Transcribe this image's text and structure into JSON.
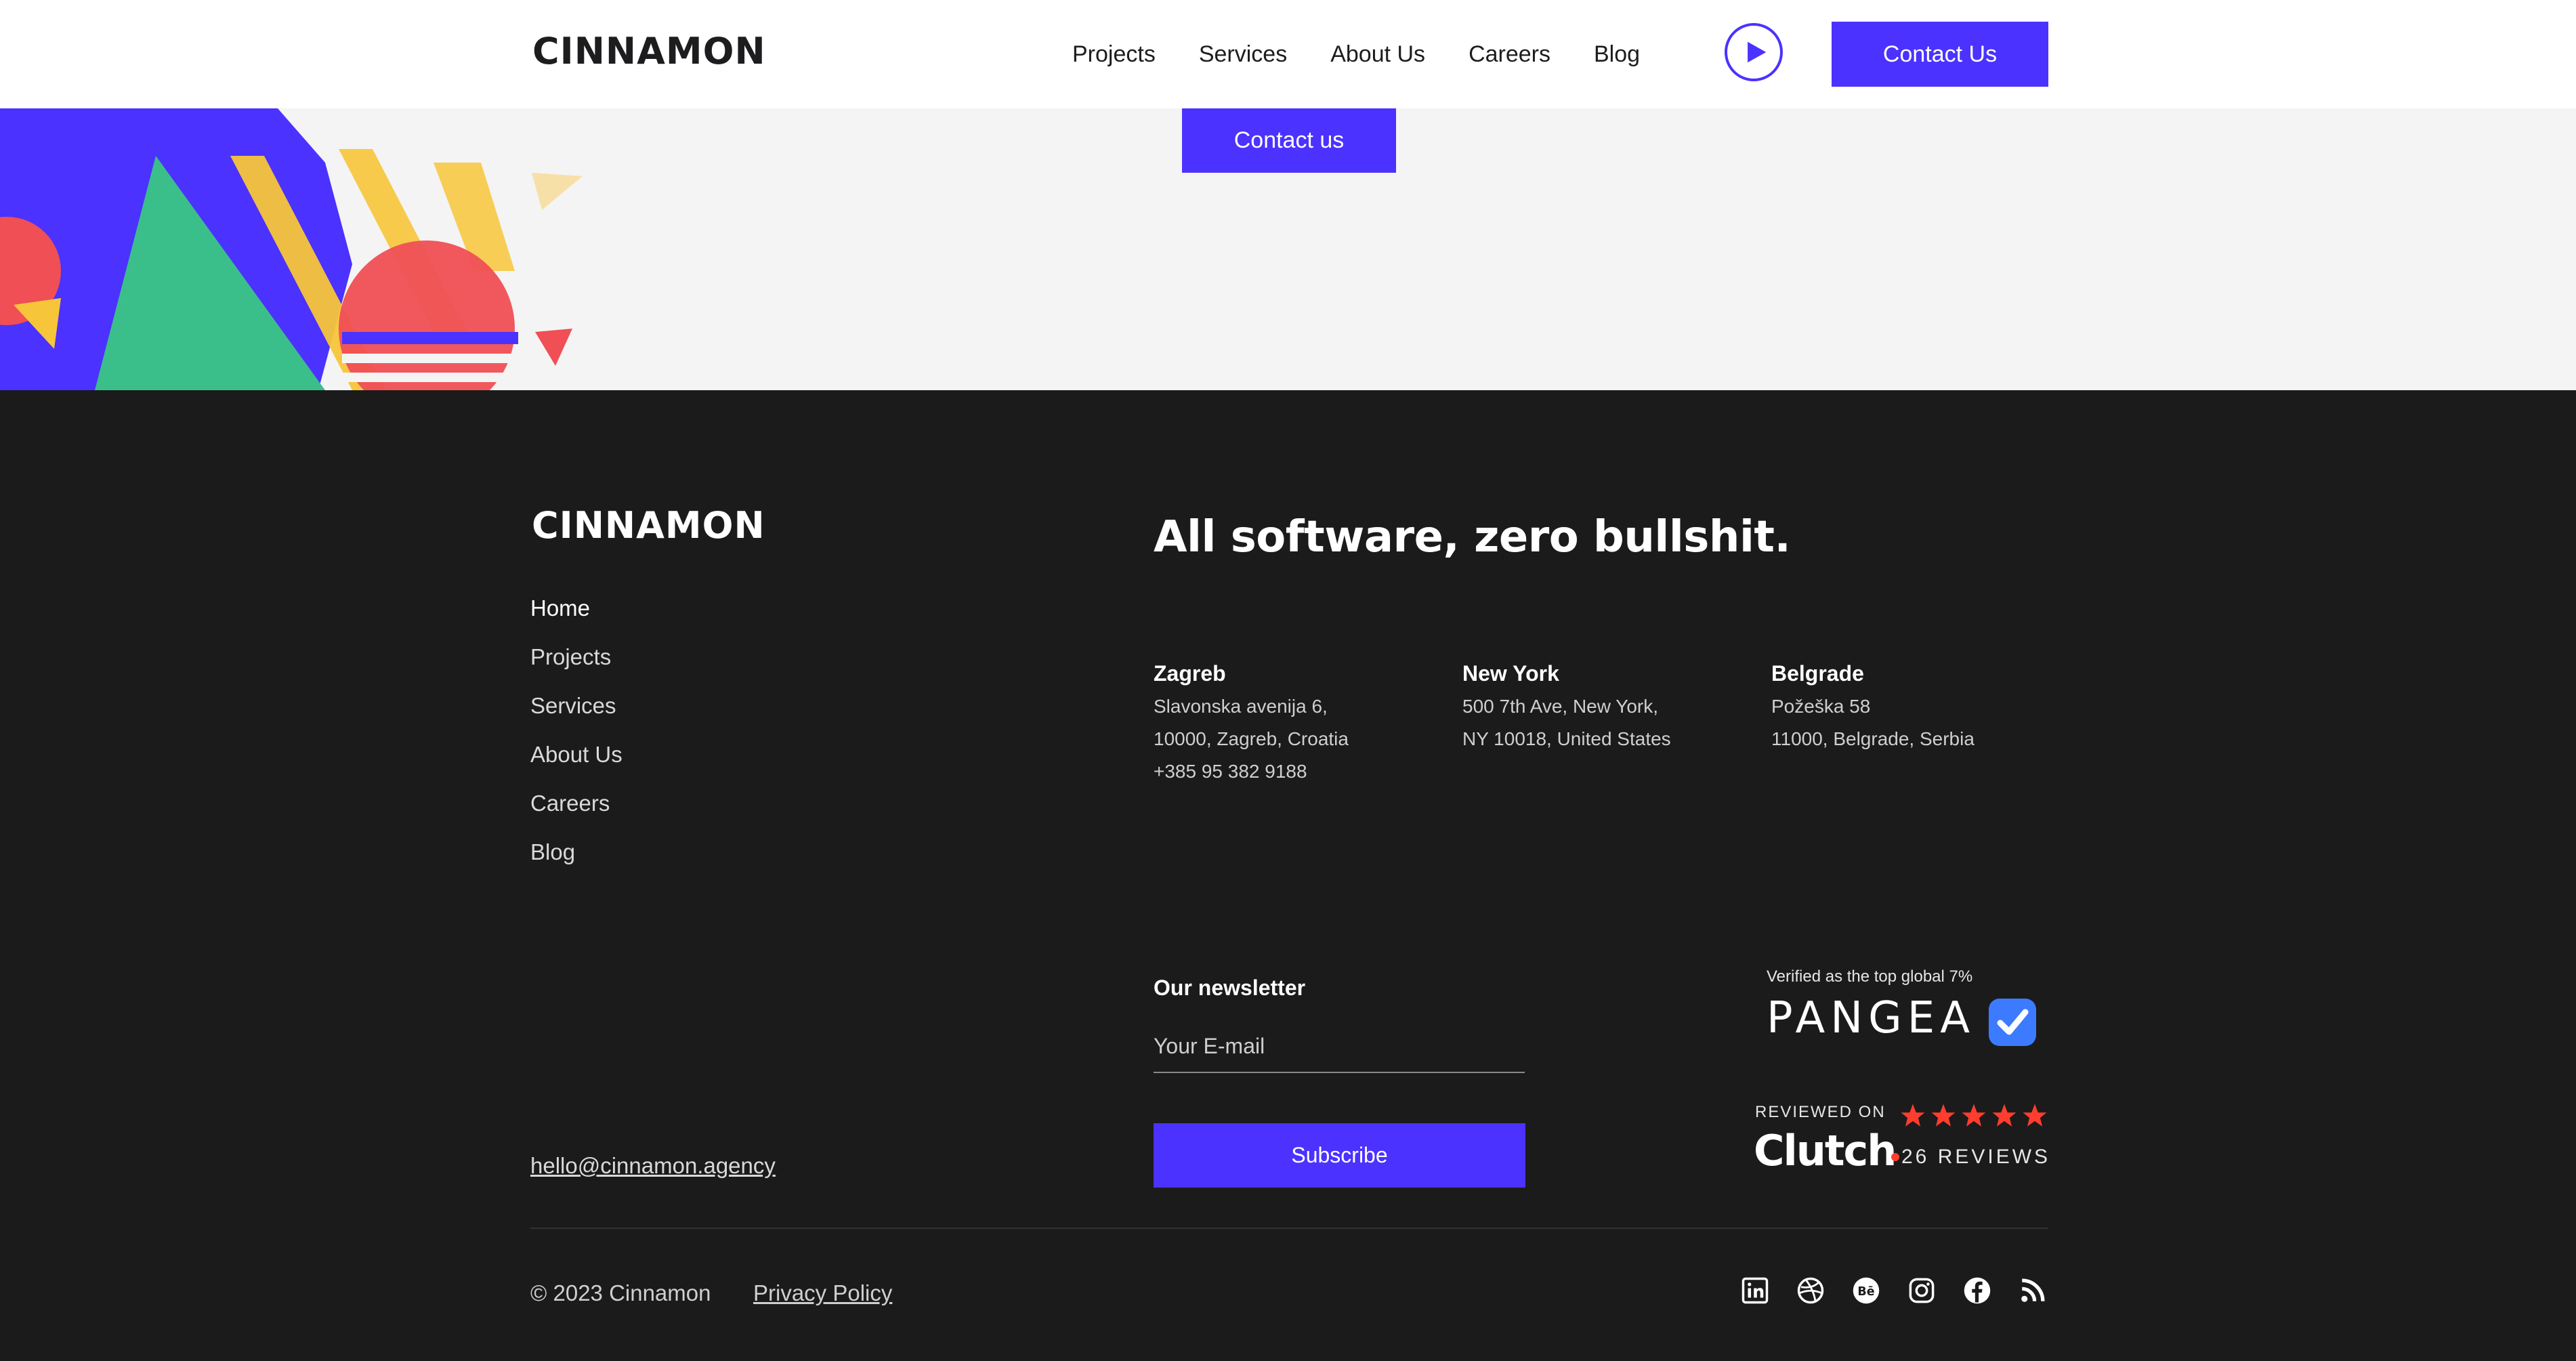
{
  "header": {
    "brand": "CINNAMON",
    "nav": [
      {
        "label": "Projects"
      },
      {
        "label": "Services"
      },
      {
        "label": "About Us"
      },
      {
        "label": "Careers"
      },
      {
        "label": "Blog"
      }
    ],
    "play_icon": "play-icon",
    "cta_label": "Contact Us"
  },
  "band": {
    "cta_label": "Contact us"
  },
  "footer": {
    "brand": "CINNAMON",
    "tagline": "All software, zero bullshit.",
    "nav": [
      {
        "label": "Home"
      },
      {
        "label": "Projects"
      },
      {
        "label": "Services"
      },
      {
        "label": "About Us"
      },
      {
        "label": "Careers"
      },
      {
        "label": "Blog"
      }
    ],
    "offices": [
      {
        "city": "Zagreb",
        "lines": [
          "Slavonska avenija 6,",
          "10000, Zagreb, Croatia",
          "+385 95 382 9188"
        ]
      },
      {
        "city": "New York",
        "lines": [
          "500 7th Ave, New York,",
          "NY 10018, United States"
        ]
      },
      {
        "city": "Belgrade",
        "lines": [
          "Požeška 58",
          "11000, Belgrade, Serbia"
        ]
      }
    ],
    "newsletter": {
      "title": "Our newsletter",
      "placeholder": "Your E-mail",
      "value": "",
      "button": "Subscribe"
    },
    "email": "hello@cinnamon.agency",
    "pangea": {
      "caption": "Verified as the top global 7%",
      "logo": "PANGEA"
    },
    "clutch": {
      "reviewed_on": "REVIEWED ON",
      "logo_text": "Clutch",
      "rating": 5,
      "reviews": "26 REVIEWS"
    },
    "copyright": "© 2023 Cinnamon",
    "privacy": "Privacy Policy",
    "socials": [
      "linkedin-icon",
      "dribbble-icon",
      "behance-icon",
      "instagram-icon",
      "facebook-icon",
      "rss-icon"
    ]
  },
  "colors": {
    "accent": "#4b32ff",
    "footer_bg": "#1b1b1b",
    "band_bg": "#f4f4f4",
    "star": "#ff3d2e"
  }
}
